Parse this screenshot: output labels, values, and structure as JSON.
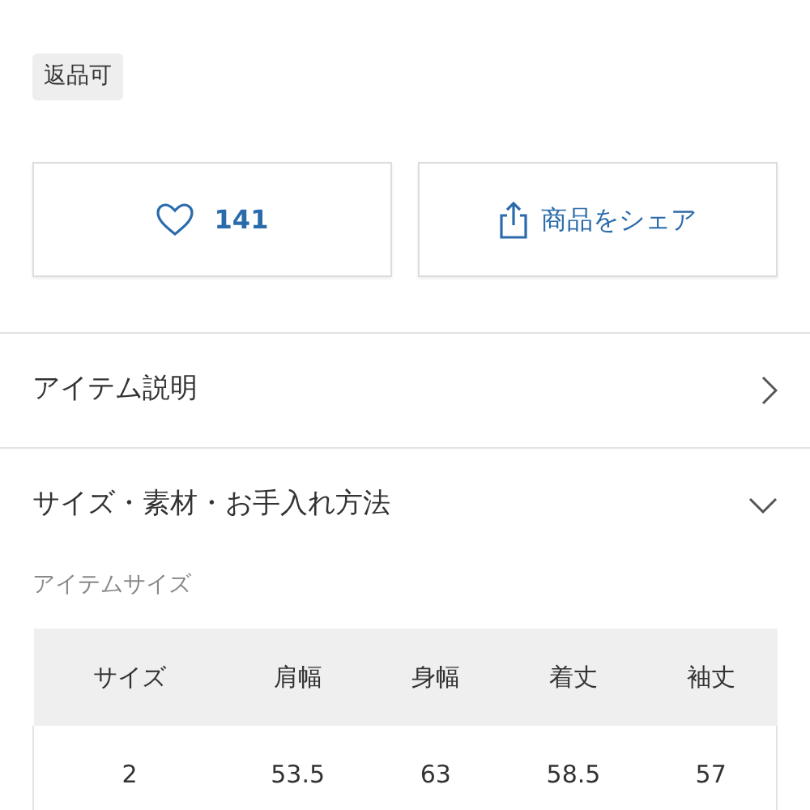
{
  "tags": [
    "返品可"
  ],
  "actions": {
    "like_count": "141",
    "share_label": "商品をシェア"
  },
  "sections": [
    {
      "title": "アイテム説明",
      "expanded": false
    },
    {
      "title": "サイズ・素材・お手入れ方法",
      "expanded": true
    }
  ],
  "size_table": {
    "title": "アイテムサイズ",
    "columns": [
      "サイズ",
      "肩幅",
      "身幅",
      "着丈",
      "袖丈"
    ],
    "rows": [
      [
        "2",
        "53.5",
        "63",
        "58.5",
        "57"
      ]
    ]
  }
}
